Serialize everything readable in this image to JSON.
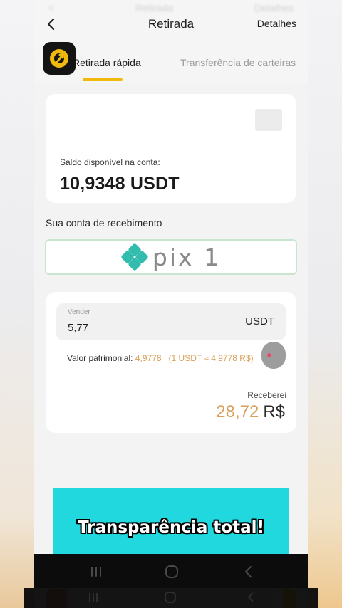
{
  "ghost_header": {
    "left": "<",
    "center": "Retirada",
    "right": "Detalhes"
  },
  "header": {
    "title": "Retirada",
    "details_label": "Detalhes"
  },
  "tabs": [
    {
      "label": "Retirada rápida",
      "active": true
    },
    {
      "label": "Transferência de carteiras",
      "active": false
    }
  ],
  "balance": {
    "label": "Saldo disponível na conta:",
    "value": "10,9348 USDT"
  },
  "receiving_account": {
    "title": "Sua conta de recebimento",
    "method": "pix",
    "method_suffix": "1"
  },
  "sell": {
    "label": "Vender",
    "value": "5,77",
    "currency": "USDT",
    "equity_label": "Valor patrimonial:",
    "equity_value": "4,9778",
    "rate": "(1 USDT ≈ 4,9778 R$)"
  },
  "receive": {
    "label": "Receberei",
    "amount": "28,72",
    "currency": "R$"
  },
  "caption": {
    "text": "Transparência total!"
  },
  "colors": {
    "accent": "#f0b90b",
    "amount": "#d8a15a",
    "pix_green": "#32bcad",
    "caption_bg": "#22d8df"
  },
  "icons": {
    "back": "chevron-left-icon",
    "logo": "app-logo-icon",
    "pix": "pix-logo-icon",
    "nav": [
      "recent-apps-icon",
      "home-icon",
      "back-icon"
    ]
  }
}
